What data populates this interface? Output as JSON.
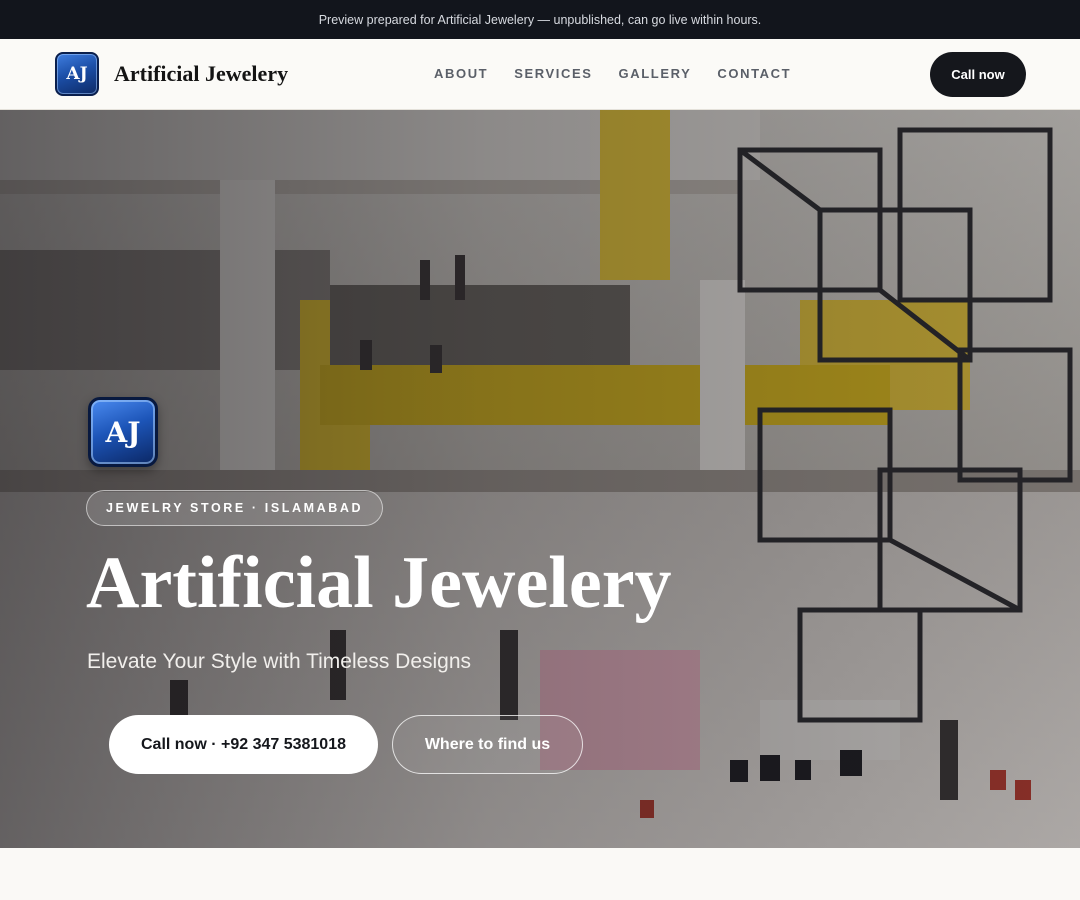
{
  "preview_bar": {
    "text": "Preview prepared for Artificial Jewelery — unpublished, can go live within hours."
  },
  "header": {
    "logo_text": "AJ",
    "brand_name": "Artificial Jewelery",
    "nav": [
      {
        "label": "ABOUT"
      },
      {
        "label": "SERVICES"
      },
      {
        "label": "GALLERY"
      },
      {
        "label": "CONTACT"
      }
    ],
    "cta_label": "Call now"
  },
  "hero": {
    "logo_text": "AJ",
    "eyebrow": "JEWELRY STORE · ISLAMABAD",
    "title": "Artificial Jewelery",
    "subtitle": "Elevate Your Style with Timeless Designs",
    "primary_button": "Call now · +92 347 5381018",
    "secondary_button": "Where to find us",
    "image_icon": "shopping-mall-photo"
  },
  "colors": {
    "header_bg": "#fbfaf7",
    "preview_bar_bg": "#12151c",
    "cta_dark": "#15171c",
    "logo_blue": "#1c4fa8"
  }
}
